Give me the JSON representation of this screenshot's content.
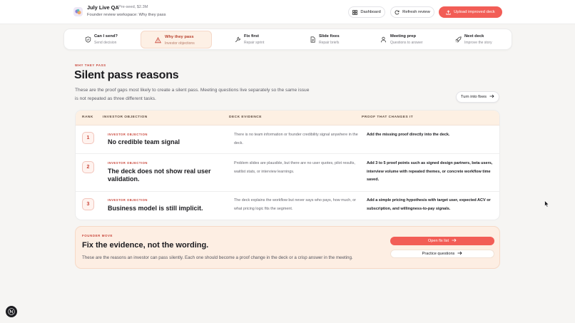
{
  "header": {
    "app_title": "July Live QA",
    "stage": "Pre-seed, $2.3M",
    "subtitle": "Founder review workspace: Why they pass",
    "dashboard_label": "Dashboard",
    "refresh_label": "Refresh review",
    "upload_label": "Upload improved deck"
  },
  "tabs": [
    {
      "label": "Can I send?",
      "sub": "Send decision",
      "icon": "shield-check-icon",
      "active": false
    },
    {
      "label": "Why they pass",
      "sub": "Investor objections",
      "icon": "warning-icon",
      "active": true
    },
    {
      "label": "Fix first",
      "sub": "Repair sprint",
      "icon": "wrench-icon",
      "active": false
    },
    {
      "label": "Slide fixes",
      "sub": "Repair briefs",
      "icon": "document-icon",
      "active": false
    },
    {
      "label": "Meeting prep",
      "sub": "Questions to answer",
      "icon": "person-icon",
      "active": false
    },
    {
      "label": "Next deck",
      "sub": "Improve the story",
      "icon": "rocket-icon",
      "active": false
    }
  ],
  "section": {
    "eyebrow": "WHY THEY PASS",
    "title": "Silent pass reasons",
    "intro": "These are the proof gaps most likely to create a silent pass. Meeting questions live separately so the same issue is not repeated as three different tasks.",
    "turn_into_fixes": "Turn into fixes"
  },
  "table": {
    "headers": {
      "rank": "RANK",
      "objection": "INVESTOR OBJECTION",
      "evidence": "DECK EVIDENCE",
      "proof": "PROOF THAT CHANGES IT"
    },
    "rows": [
      {
        "rank": "1",
        "kicker": "INVESTOR OBJECTION",
        "title": "No credible team signal",
        "evidence": "There is no team information or founder credibility signal anywhere in the deck.",
        "proof": "Add the missing proof directly into the deck."
      },
      {
        "rank": "2",
        "kicker": "INVESTOR OBJECTION",
        "title": "The deck does not show real user validation.",
        "evidence": "Problem slides are plausible, but there are no user quotes, pilot results, waitlist stats, or interview learnings.",
        "proof": "Add 3 to 5 proof points such as signed design partners, beta users, interview volume with repeated themes, or concrete workflow time saved."
      },
      {
        "rank": "3",
        "kicker": "INVESTOR OBJECTION",
        "title": "Business model is still implicit.",
        "evidence": "The deck explains the workflow but never says who pays, how much, or what pricing logic fits the segment.",
        "proof": "Add a simple pricing hypothesis with target user, expected ACV or subscription, and willingness-to-pay signals."
      }
    ]
  },
  "founder_move": {
    "eyebrow": "FOUNDER MOVE",
    "title": "Fix the evidence, not the wording.",
    "description": "These are the reasons an investor can pass silently. Each one should become a proof change in the deck or a crisp answer in the meeting.",
    "open_fix_list": "Open fix list",
    "practice_questions": "Practice questions"
  },
  "badge": {
    "letter": "N"
  },
  "colors": {
    "accent": "#f25d56",
    "accent_text": "#c9463a",
    "tint": "#fdf0e3"
  }
}
